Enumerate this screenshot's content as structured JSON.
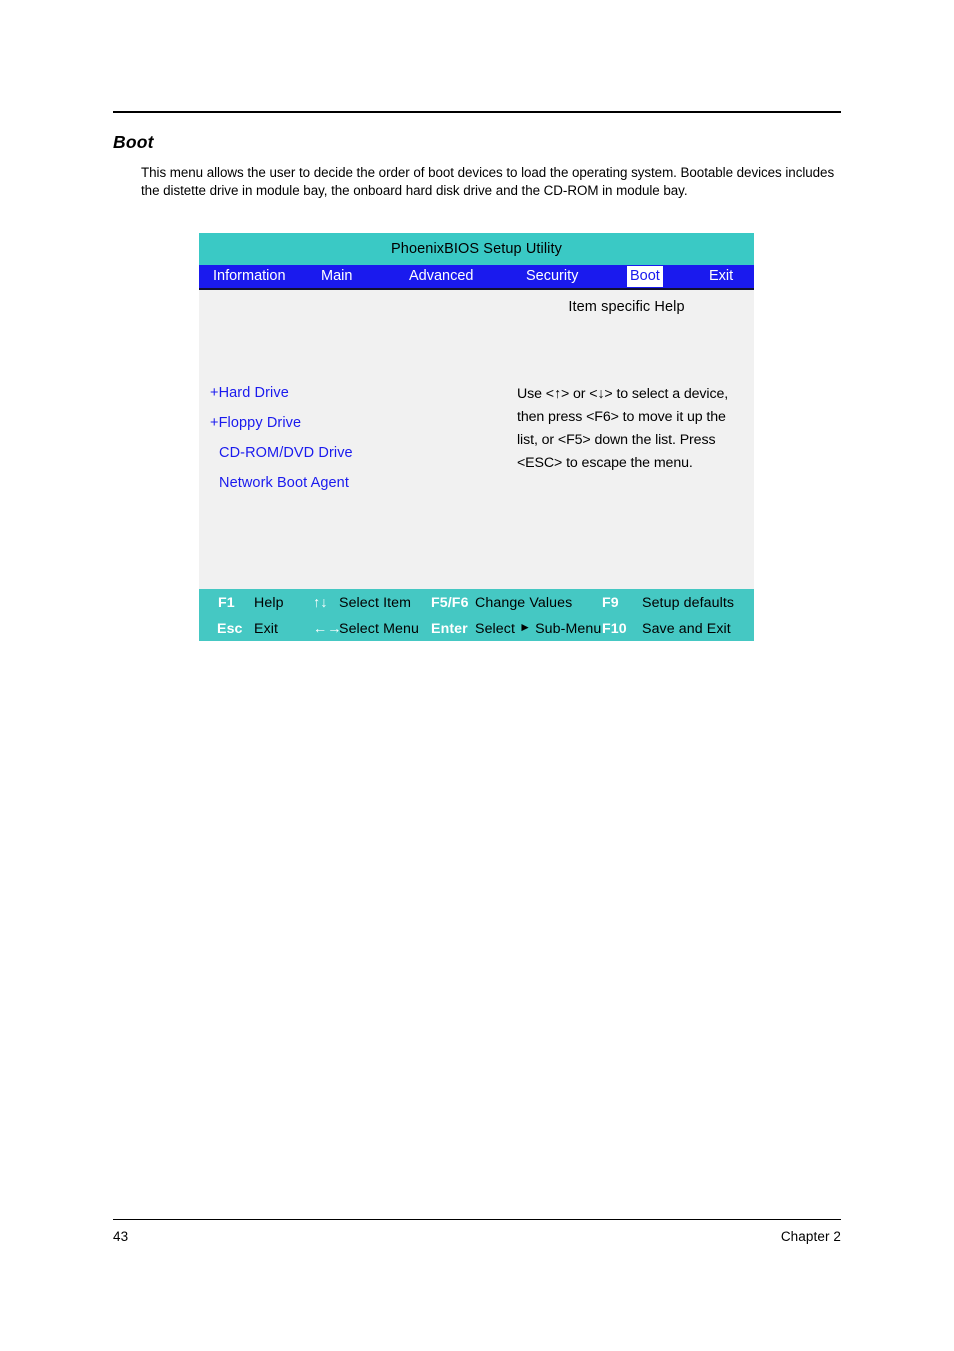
{
  "document": {
    "section_heading": "Boot",
    "body_paragraph": "This menu allows the user to decide the order of boot devices to load the operating system. Bootable devices includes the distette drive in module bay, the onboard hard disk drive and the CD-ROM in module bay.",
    "page_number": "43",
    "chapter_label": "Chapter 2"
  },
  "bios": {
    "title": "PhoenixBIOS Setup Utility",
    "colors": {
      "titlebar": "#3ac9c5",
      "menubar": "#1a1aee",
      "body": "#f1f1f1",
      "footer": "#45c8c3",
      "item_text": "#1a1aee",
      "selected_tab_bg": "#ffffff"
    },
    "menu": [
      {
        "label": "Information",
        "selected": false
      },
      {
        "label": "Main",
        "selected": false
      },
      {
        "label": "Advanced",
        "selected": false
      },
      {
        "label": "Security",
        "selected": false
      },
      {
        "label": "Boot",
        "selected": true
      },
      {
        "label": "Exit",
        "selected": false
      }
    ],
    "boot_order": [
      {
        "label": "+Hard Drive",
        "expandable": true
      },
      {
        "label": "+Floppy Drive",
        "expandable": true
      },
      {
        "label": "CD-ROM/DVD Drive",
        "expandable": false
      },
      {
        "label": "Network Boot Agent",
        "expandable": false
      }
    ],
    "help": {
      "title": "Item specific Help",
      "lines": [
        "Use <↑> or <↓> to select a device,",
        "then press <F6> to move it up the",
        "list, or <F5> down the list. Press",
        "<ESC> to escape the menu."
      ]
    },
    "footer_keys": [
      {
        "key": "F1",
        "desc": "Help"
      },
      {
        "key": "↑↓",
        "desc": "Select Item"
      },
      {
        "key": "F5/F6",
        "desc": "Change Values"
      },
      {
        "key": "F9",
        "desc": "Setup defaults"
      },
      {
        "key": "Esc",
        "desc": "Exit"
      },
      {
        "key": "←→",
        "desc": "Select Menu"
      },
      {
        "key": "Enter",
        "desc_pre": "Select",
        "desc_post": "Sub-Menu"
      },
      {
        "key": "F10",
        "desc": "Save and Exit"
      }
    ]
  }
}
